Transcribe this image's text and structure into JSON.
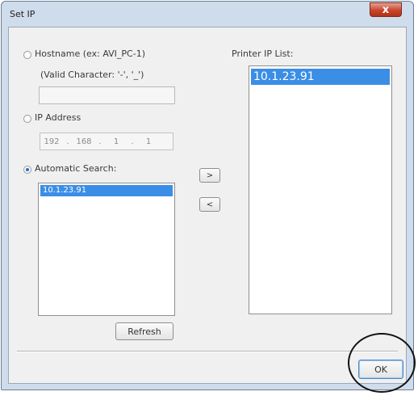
{
  "window": {
    "title": "Set IP",
    "close_glyph": "x"
  },
  "hostname": {
    "label": "Hostname (ex: AVI_PC-1)",
    "hint": "(Valid Character: '-', '_')",
    "value": ""
  },
  "ip_address": {
    "label": "IP Address",
    "octets": [
      "192",
      "168",
      "1",
      "1"
    ],
    "separator": "."
  },
  "automatic_search": {
    "label": "Automatic Search:",
    "selected": true,
    "results": [
      "10.1.23.91"
    ],
    "refresh_label": "Refresh"
  },
  "hostname_selected": false,
  "ip_selected": false,
  "transfer": {
    "add_label": ">",
    "remove_label": "<"
  },
  "printer_list": {
    "label": "Printer IP List:",
    "items": [
      "10.1.23.91"
    ]
  },
  "ok_label": "OK"
}
